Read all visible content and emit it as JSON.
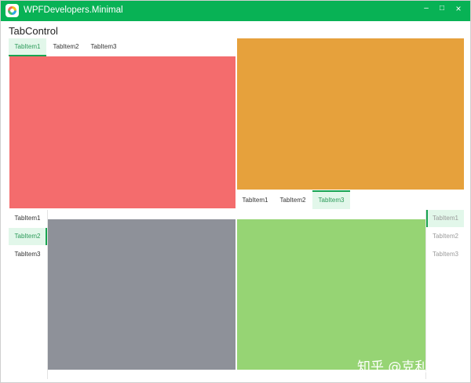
{
  "window": {
    "title": "WPFDevelopers.Minimal",
    "controls": {
      "minimize": "–",
      "maximize": "□",
      "close": "×"
    }
  },
  "page": {
    "title": "TabControl"
  },
  "tabs_top_left": {
    "items": [
      "TabItem1",
      "TabItem2",
      "TabItem3"
    ],
    "selected": 0
  },
  "tabs_bottom_right": {
    "items": [
      "TabItem1",
      "TabItem2",
      "TabItem3"
    ],
    "selected": 2
  },
  "tabs_left": {
    "items": [
      "TabItem1",
      "TabItem2",
      "TabItem3"
    ],
    "selected": 1
  },
  "tabs_right": {
    "items": [
      "TabItem1",
      "TabItem2",
      "TabItem3"
    ],
    "selected": 0
  },
  "panels": {
    "top_left": {
      "color": "#f46c6d"
    },
    "top_right": {
      "color": "#e6a13c"
    },
    "bottom_left": {
      "color": "#8e9199"
    },
    "bottom_right": {
      "color": "#96d474"
    }
  },
  "theme": {
    "accent": "#08b255",
    "selected_tab_bg": "#e2f7ea",
    "indicator": "#19a451"
  },
  "watermark": "知乎 @克利马古"
}
